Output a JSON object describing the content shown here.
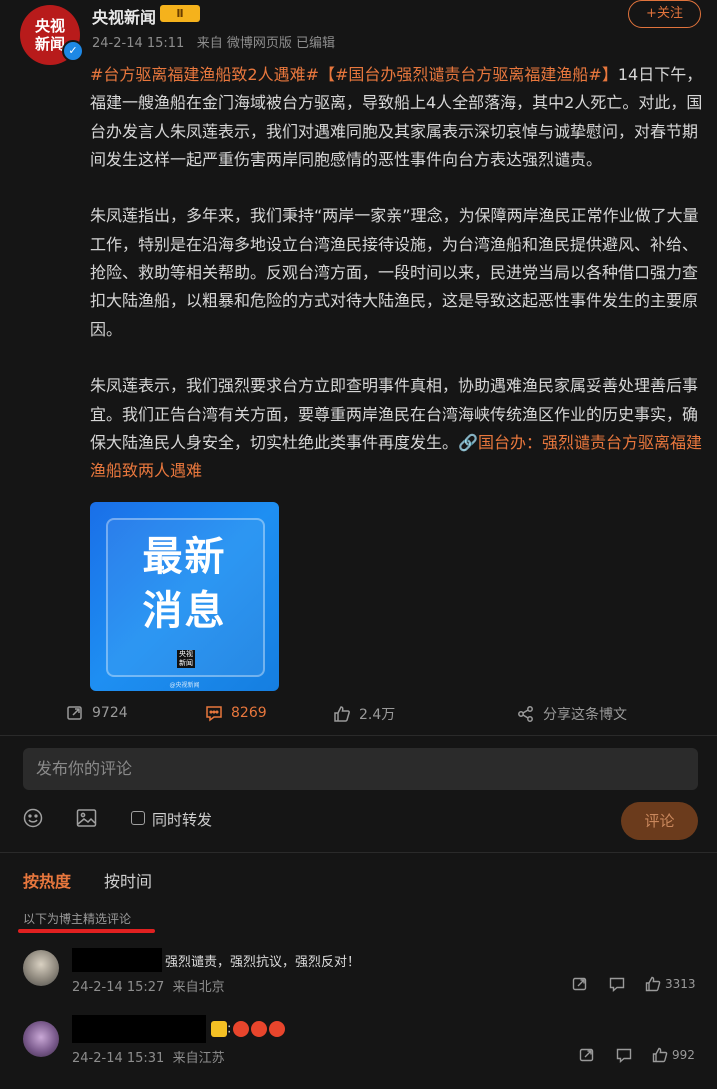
{
  "author": {
    "name": "央视新闻",
    "badge": "Ⅱ",
    "avatar_text": [
      "央视",
      "新闻"
    ]
  },
  "meta": {
    "time": "24-2-14 15:11",
    "source": "来自 微博网页版 已编辑"
  },
  "follow_label": "+关注",
  "post": {
    "tag1": "#台方驱离福建渔船致2人遇难#",
    "tag2": "【#国台办强烈谴责台方驱离福建渔船#】",
    "p1_rest": "14日下午，福建一艘渔船在金门海域被台方驱离，导致船上4人全部落海，其中2人死亡。对此，国台办发言人朱凤莲表示，我们对遇难同胞及其家属表示深切哀悼与诚挚慰问，对春节期间发生这样一起严重伤害两岸同胞感情的恶性事件向台方表达强烈谴责。",
    "p2": "朱凤莲指出，多年来，我们秉持“两岸一家亲”理念，为保障两岸渔民正常作业做了大量工作，特别是在沿海多地设立台湾渔民接待设施，为台湾渔船和渔民提供避风、补给、抢险、救助等相关帮助。反观台湾方面，一段时间以来，民进党当局以各种借口强力查扣大陆渔船，以粗暴和危险的方式对待大陆渔民，这是导致这起恶性事件发生的主要原因。",
    "p3": "朱凤莲表示，我们强烈要求台方立即查明事件真相，协助遇难渔民家属妥善处理善后事宜。我们正告台湾有关方面，要尊重两岸渔民在台湾海峡传统渔区作业的历史事实，确保大陆渔民人身安全，切实杜绝此类事件再度发生。",
    "link": "🔗国台办：强烈谴责台方驱离福建渔船致两人遇难"
  },
  "media": {
    "text1": "最新",
    "text2": "消息",
    "logo": [
      "央视",
      "新闻"
    ],
    "small": "@央视新闻"
  },
  "actions": {
    "repost": "9724",
    "comment": "8269",
    "like": "2.4万",
    "share": "分享这条博文"
  },
  "comment_box": {
    "placeholder": "发布你的评论",
    "repost_label": "同时转发",
    "submit": "评论"
  },
  "tabs": {
    "hot": "按热度",
    "time": "按时间"
  },
  "featured_note": "以下为博主精选评论",
  "comments": [
    {
      "text": "强烈谴责，强烈抗议，强烈反对！",
      "time": "24-2-14 15:27",
      "location": "来自北京",
      "likes": "3313"
    },
    {
      "text": ":",
      "time": "24-2-14 15:31",
      "location": "来自江苏",
      "likes": "992"
    }
  ],
  "colors": {
    "accent": "#e8773d",
    "background": "#151515",
    "media_blue": "#1e8ff2"
  }
}
